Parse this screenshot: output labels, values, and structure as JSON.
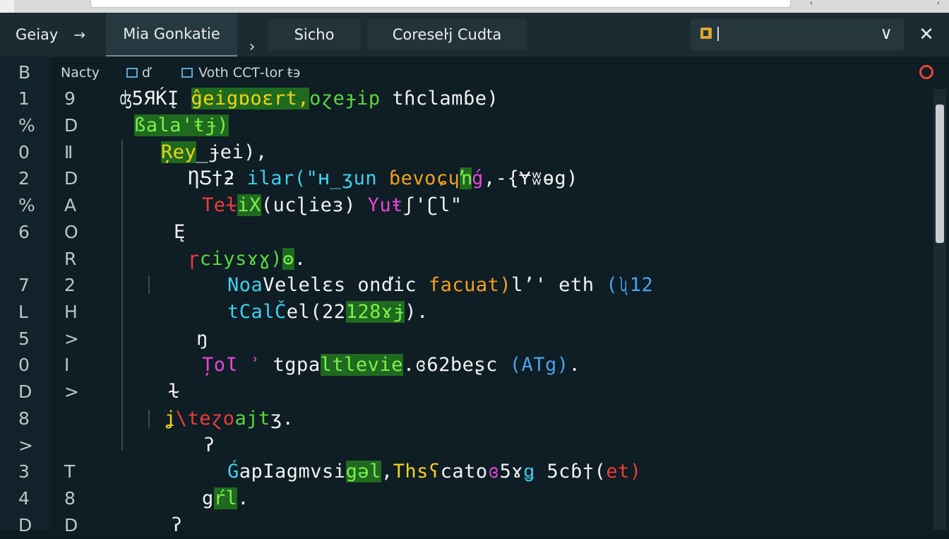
{
  "tabs": {
    "t1": {
      "label": "Geiay",
      "arrow": "→"
    },
    "t2": {
      "label": "Mia Gonkatie"
    },
    "sep": "›",
    "t3": {
      "label": "Sicho"
    },
    "t4": {
      "label": "Coreseŀj  Cudta"
    }
  },
  "selector": {
    "chevron": "∨"
  },
  "close": "✕",
  "header": {
    "label1": "Nacty",
    "label2": "ď",
    "label3": "Voth CCƬ-Ɩor ŧ϶"
  },
  "gutter1": [
    "B",
    "1",
    "%",
    "0",
    "2",
    "%",
    "6",
    "",
    "7",
    "L",
    "5",
    "0",
    "D",
    "8",
    ">",
    "3",
    "4",
    "D"
  ],
  "gutter2": [
    "",
    "9",
    "D",
    "Ⅱ",
    "D",
    "A",
    "O",
    "R",
    "2",
    "H",
    ">",
    "I",
    ">",
    "",
    "",
    "T",
    "8",
    "D"
  ],
  "code": {
    "l1": [
      "ʤ5ЯЌĮ ",
      "ĝeigɒoɛrt,",
      "oɀeɟip ",
      "tɦclamɓe)"
    ],
    "l2": [
      "ßala'ŧɉ)"
    ],
    "l3": [
      "Ŗey",
      "_ɉei), "
    ],
    "l4": [
      "ȠƼ†ƻ ",
      "ilar(\"ʜ_ʒun ",
      "ɓevoɕɥ",
      "ŉ",
      "ǵ",
      ",-{Ɏʬɵg)"
    ],
    "l5": [
      "Teɫ",
      "iX",
      "(ucɭieɜ) ",
      "Yuŧ",
      "ʃ'ʗl\""
    ],
    "l6": [
      "Ę"
    ],
    "l7": [
      "ɼ",
      "ciysɤɣ)",
      "ʘ",
      "."
    ],
    "l8": [
      "Noa",
      "Velelɛs onďic ",
      "facuat)",
      "lʼ' eth ",
      "(ʯ12"
    ],
    "l9": [
      "tCalČ",
      "el(22",
      "128ɤɉ",
      ")."
    ],
    "l10": [
      "ŋ"
    ],
    "l11": [
      "ȚoƖ ʾ ",
      "tgpa",
      "ltlevie",
      ".ɞ62beʂc ",
      "(ATg)",
      "."
    ],
    "l12": [
      "ɫ"
    ],
    "l13": [
      "ʝ",
      "\\teɀo",
      "ajt",
      "ʒ."
    ],
    "l14": [
      "ʔ"
    ],
    "l15": [
      "Ǵ",
      "apIagmvsi",
      "gəl",
      ",",
      "Thsʕ",
      "cato",
      "ɞ",
      "5ɤ",
      "ǥ",
      " 5cɓ",
      "†(",
      "et)"
    ],
    "l16": [
      "g",
      "ŕl",
      "."
    ],
    "l17": [
      "ʔ"
    ]
  }
}
